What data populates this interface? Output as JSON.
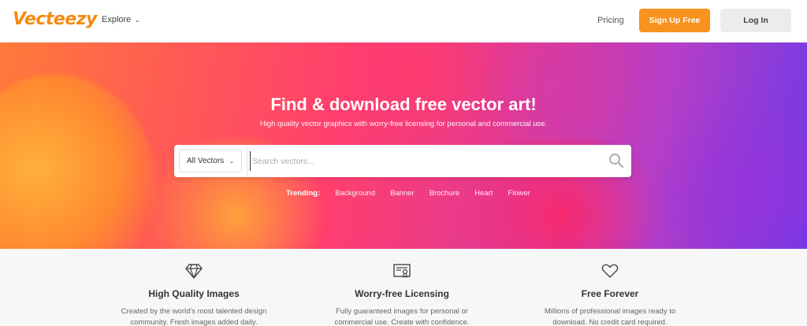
{
  "header": {
    "logo": "Vecteezy",
    "explore_label": "Explore",
    "pricing_label": "Pricing",
    "signup_label": "Sign Up Free",
    "login_label": "Log In"
  },
  "hero": {
    "title": "Find & download free vector art!",
    "subtitle": "High quality vector graphics with worry-free licensing for personal and commercial use.",
    "search": {
      "category_selected": "All Vectors",
      "placeholder": "Search vectors...",
      "value": ""
    },
    "trending": {
      "label": "Trending:",
      "tags": [
        "Background",
        "Banner",
        "Brochure",
        "Heart",
        "Flower"
      ]
    }
  },
  "features": [
    {
      "icon": "diamond-icon",
      "title": "High Quality Images",
      "description": "Created by the world's most talented design community. Fresh images added daily."
    },
    {
      "icon": "certificate-icon",
      "title": "Worry-free Licensing",
      "description": "Fully guaranteed images for personal or commercial use. Create with confidence."
    },
    {
      "icon": "heart-icon",
      "title": "Free Forever",
      "description": "Millions of professional images ready to download. No credit card required."
    }
  ],
  "colors": {
    "brand": "#f38b13",
    "signup_bg": "#f7931e",
    "login_bg": "#ececec"
  }
}
